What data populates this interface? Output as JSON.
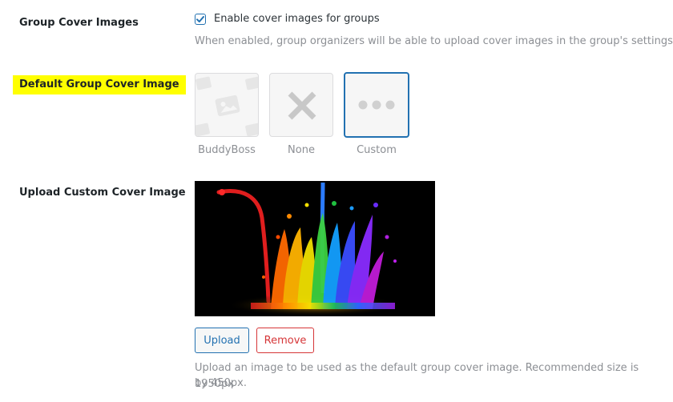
{
  "rows": {
    "cover_images": {
      "label": "Group Cover Images",
      "checkbox_label": "Enable cover images for groups",
      "checked": true,
      "description": "When enabled, group organizers will be able to upload cover images in the group's settings"
    },
    "default_cover": {
      "label": "Default Group Cover Image",
      "highlight_color": "#ffff00",
      "options": [
        {
          "caption": "BuddyBoss",
          "icon": "image-pattern-icon",
          "selected": false
        },
        {
          "caption": "None",
          "icon": "x-icon",
          "selected": false
        },
        {
          "caption": "Custom",
          "icon": "more-dots-icon",
          "selected": true
        }
      ]
    },
    "custom_cover": {
      "label": "Upload Custom Cover Image",
      "image_alt": "rainbow paint splash on black background",
      "upload_label": "Upload",
      "remove_label": "Remove",
      "description_line1": "Upload an image to be used as the default group cover image. Recommended size is 1950px",
      "description_line2": "by 450px."
    }
  },
  "colors": {
    "accent": "#2271b1",
    "danger": "#d63638",
    "muted": "#8c8f94"
  }
}
